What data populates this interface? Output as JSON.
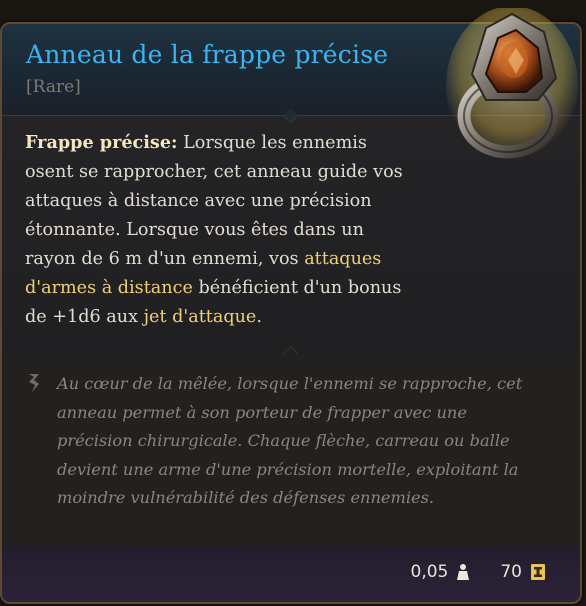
{
  "item": {
    "name": "Anneau de la frappe précise",
    "rarity": "[Rare]",
    "description": {
      "label": "Frappe précise:",
      "text_1": " Lorsque les ennemis osent se rapprocher, cet anneau guide vos attaques à distance avec une précision étonnante.  Lorsque vous êtes dans un rayon de 6 m d'un ennemi, vos ",
      "link_1": "attaques d'armes à distance",
      "text_2": " bénéficient d'un bonus de +1d6 aux ",
      "link_2": "jet d'attaque",
      "text_3": "."
    },
    "flavor": "Au cœur de la mêlée, lorsque l'ennemi se rapproche, cet anneau permet à son porteur de frapper avec une précision chirurgicale. Chaque flèche, carreau ou balle devient une arme d'une précision mortelle, exploitant la moindre vulnérabilité des défenses ennemies.",
    "weight": "0,05",
    "value": "70"
  },
  "colors": {
    "title": "#3ab4f2",
    "highlight": "#f0cf77",
    "text": "#e3dcd0",
    "flavor": "#8a8580"
  },
  "icons": {
    "item": "ring-icon",
    "flavor": "quill-icon",
    "weight": "weight-icon",
    "value": "gold-coin-icon"
  }
}
